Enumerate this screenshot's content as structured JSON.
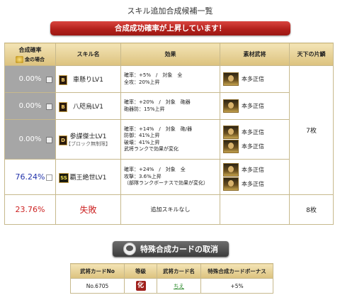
{
  "page_title": "スキル追加合成候補一覧",
  "banner": "合成成功確率が上昇しています！",
  "table": {
    "headers": {
      "rate": "合成確率",
      "gold_case": "金の場合",
      "skill": "スキル名",
      "effect": "効果",
      "material": "素材武将",
      "tenka": "天下の片鱗"
    },
    "rows": [
      {
        "rate": "0.00%",
        "rank": "B",
        "skill": "車懸りLV1",
        "effect": [
          "確率：+5%　/　対象　全",
          "全攻：20%上昇"
        ],
        "materials": [
          "本多正信"
        ]
      },
      {
        "rate": "0.00%",
        "rank": "B",
        "skill": "八咫烏LV1",
        "effect": [
          "確率：+20%　/　対象　砲器",
          "砲器防：15%上昇"
        ],
        "materials": [
          "本多正信"
        ]
      },
      {
        "rate": "0.00%",
        "rank": "D",
        "skill": "参謀傑士LV1",
        "sub": "【ブロック無制限】",
        "effect": [
          "確率：+14%　/　対象　砲/器",
          "防御：41%上昇",
          "破壊：41%上昇",
          "武将ランクで効果が変化"
        ],
        "materials": [
          "本多正信",
          "本多正信"
        ]
      },
      {
        "rate": "76.24%",
        "rank": "SS",
        "skill": "覇王絶世LV1",
        "effect": [
          "確率：+24%　/　対象　全",
          "攻撃：3.6%上昇",
          "（部隊ランクボーナスで効果が変化）"
        ],
        "materials": [
          "本多正信",
          "本多正信"
        ]
      }
    ],
    "tenka_count": "7枚",
    "fail": {
      "rate": "23.76%",
      "label": "失敗",
      "effect": "追加スキルなし",
      "tenka": "8枚"
    }
  },
  "cancel_button": "特殊合成カードの取消",
  "info_table": {
    "headers": [
      "武将カードNo",
      "等級",
      "武将カード名",
      "特殊合成カードボーナス"
    ],
    "row": {
      "no": "No.6705",
      "grade": "化",
      "name": "ちえ",
      "bonus": "+5%"
    }
  }
}
